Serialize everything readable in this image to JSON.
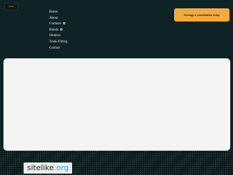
{
  "header": {
    "logo_text": "Ross",
    "nav": [
      {
        "label": "Home",
        "has_dropdown": false
      },
      {
        "label": "About",
        "has_dropdown": false
      },
      {
        "label": "Curtains",
        "has_dropdown": true
      },
      {
        "label": "Blinds",
        "has_dropdown": true
      },
      {
        "label": "Shutters",
        "has_dropdown": false
      },
      {
        "label": "Trade Fitting",
        "has_dropdown": false
      },
      {
        "label": "Contact",
        "has_dropdown": false
      }
    ],
    "cta_label": "Arrange a consultation today"
  },
  "watermark": {
    "main": "sitelike",
    "tld": ".org"
  },
  "colors": {
    "header_bg": "#0f2224",
    "cta_bg": "#f3aa3c",
    "hero_bg": "#f4f4f4",
    "footer_bg": "#0b1a1b"
  },
  "icons": {
    "nav_dropdown": "chevron-down-icon"
  }
}
